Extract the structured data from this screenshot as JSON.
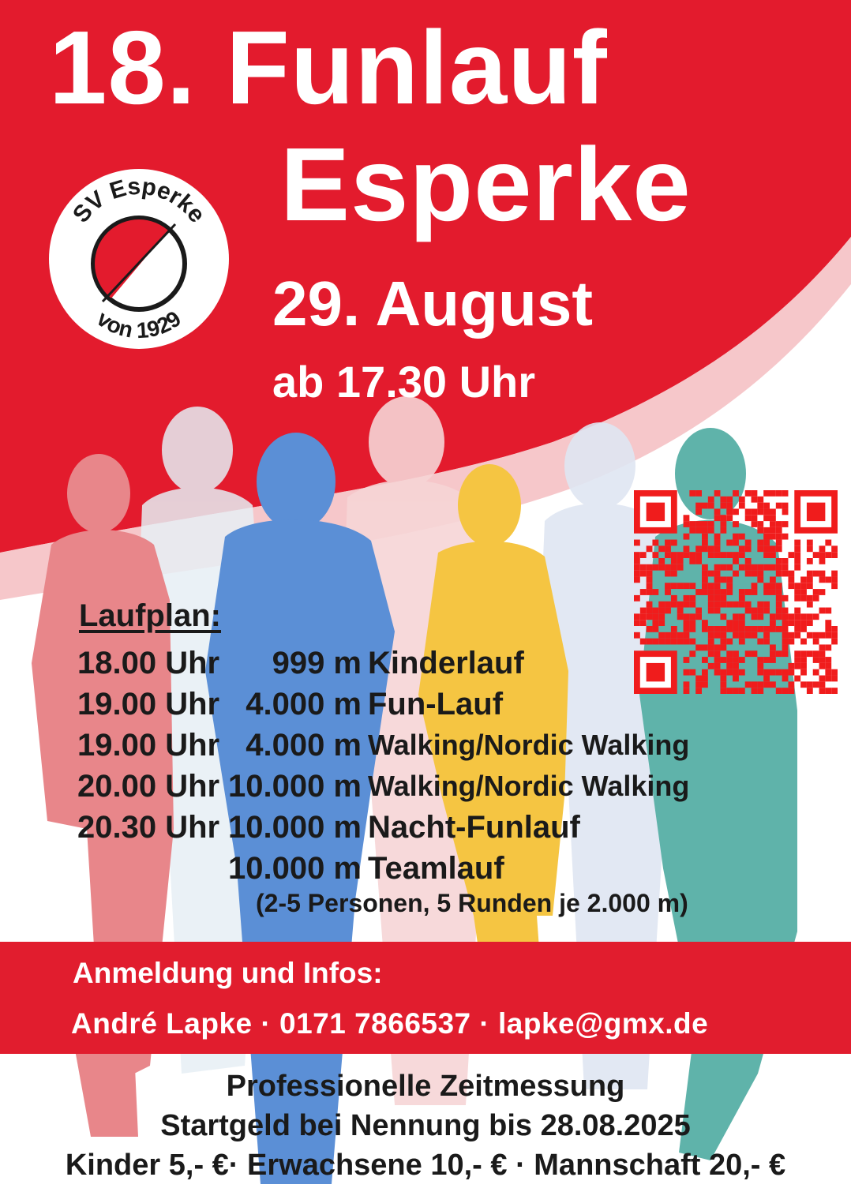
{
  "header": {
    "title_line1": "18. Funlauf",
    "title_line2": "Esperke",
    "date": "29. August",
    "time": "ab 17.30 Uhr"
  },
  "logo": {
    "name": "SV Esperke",
    "since": "von 1929"
  },
  "laufplan": {
    "heading": "Laufplan:",
    "rows": [
      {
        "time": "18.00 Uhr",
        "distance": "999 m",
        "name": "Kinderlauf"
      },
      {
        "time": "19.00 Uhr",
        "distance": "4.000 m",
        "name": "Fun-Lauf"
      },
      {
        "time": "19.00 Uhr",
        "distance": "4.000 m",
        "name": "Walking/Nordic Walking"
      },
      {
        "time": "20.00 Uhr",
        "distance": "10.000 m",
        "name": "Walking/Nordic Walking"
      },
      {
        "time": "20.30 Uhr",
        "distance": "10.000 m",
        "name": "Nacht-Funlauf"
      },
      {
        "time": "",
        "distance": "10.000 m",
        "name": "Teamlauf"
      }
    ],
    "note": "(2-5 Personen, 5 Runden je 2.000 m)"
  },
  "registration": {
    "heading": "Anmeldung und Infos:",
    "contact": "André Lapke · 0171 7866537 · lapke@gmx.de"
  },
  "footer": {
    "line1": "Professionelle Zeitmessung",
    "line2": "Startgeld bei Nennung bis 28.08.2025",
    "line3": "Kinder 5,- €· Erwachsene 10,- € · Mannschaft 20,- €"
  },
  "colors": {
    "brand_red": "#e11d2e",
    "runner_red": "#e8868a",
    "runner_blue": "#5b8fd6",
    "runner_yellow": "#f5c542",
    "runner_teal": "#5fb3aa"
  },
  "icons": {
    "qr": "qr-code-icon",
    "logo": "club-logo-icon"
  }
}
